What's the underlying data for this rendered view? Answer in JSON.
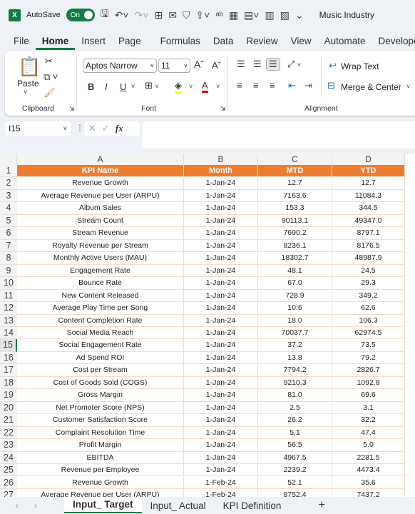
{
  "titlebar": {
    "autosave_label": "AutoSave",
    "autosave_state": "On",
    "doc_title": "Music Industry"
  },
  "menu_tabs": [
    "File",
    "Home",
    "Insert",
    "Page Layout",
    "Formulas",
    "Data",
    "Review",
    "View",
    "Automate",
    "Developer"
  ],
  "active_tab": "Home",
  "ribbon": {
    "paste": "Paste",
    "font_name": "Aptos Narrow",
    "font_size": "11",
    "wrap_text": "Wrap Text",
    "merge_center": "Merge & Center",
    "groups": {
      "clipboard": "Clipboard",
      "font": "Font",
      "alignment": "Alignment"
    },
    "bold": "B",
    "italic": "I",
    "underline": "U",
    "grow": "Aˆ",
    "shrink": "Aˇ",
    "font_color": "A",
    "fill_color": "#ffff00",
    "font_color_hex": "#e00000"
  },
  "formula_bar": {
    "name_box": "I15",
    "fx": "fx",
    "formula": ""
  },
  "columns": [
    "A",
    "B",
    "C",
    "D"
  ],
  "header": [
    "KPI Name",
    "Month",
    "MTD",
    "YTD"
  ],
  "rows": [
    [
      "Revenue Growth",
      "1-Jan-24",
      "12.7",
      "12.7"
    ],
    [
      "Average Revenue per User (ARPU)",
      "1-Jan-24",
      "7163.6",
      "11084.3"
    ],
    [
      "Album Sales",
      "1-Jan-24",
      "153.3",
      "344.5"
    ],
    [
      "Stream Count",
      "1-Jan-24",
      "90113.1",
      "49347.0"
    ],
    [
      "Stream Revenue",
      "1-Jan-24",
      "7690.2",
      "8797.1"
    ],
    [
      "Royalty Revenue per Stream",
      "1-Jan-24",
      "8236.1",
      "8176.5"
    ],
    [
      "Monthly Active Users (MAU)",
      "1-Jan-24",
      "18302.7",
      "48987.9"
    ],
    [
      "Engagement Rate",
      "1-Jan-24",
      "48.1",
      "24.5"
    ],
    [
      "Bounce Rate",
      "1-Jan-24",
      "67.0",
      "29.3"
    ],
    [
      "New Content Released",
      "1-Jan-24",
      "728.9",
      "349.2"
    ],
    [
      "Average Play Time per Song",
      "1-Jan-24",
      "10.6",
      "62.6"
    ],
    [
      "Content Completion Rate",
      "1-Jan-24",
      "18.0",
      "106.3"
    ],
    [
      "Social Media Reach",
      "1-Jan-24",
      "70037.7",
      "62974.5"
    ],
    [
      "Social Engagement Rate",
      "1-Jan-24",
      "37.2",
      "73.5"
    ],
    [
      "Ad Spend ROI",
      "1-Jan-24",
      "13.8",
      "79.2"
    ],
    [
      "Cost per Stream",
      "1-Jan-24",
      "7794.2",
      "2826.7"
    ],
    [
      "Cost of Goods Sold (COGS)",
      "1-Jan-24",
      "9210.3",
      "1092.8"
    ],
    [
      "Gross Margin",
      "1-Jan-24",
      "81.0",
      "69.6"
    ],
    [
      "Net Promoter Score (NPS)",
      "1-Jan-24",
      "2.5",
      "3.1"
    ],
    [
      "Customer Satisfaction Score",
      "1-Jan-24",
      "26.2",
      "32.2"
    ],
    [
      "Complaint Resolution Time",
      "1-Jan-24",
      "5.1",
      "47.4"
    ],
    [
      "Profit Margin",
      "1-Jan-24",
      "56.5",
      "5.0"
    ],
    [
      "EBITDA",
      "1-Jan-24",
      "4967.5",
      "2281.5"
    ],
    [
      "Revenue per Employee",
      "1-Jan-24",
      "2239.2",
      "4473.4"
    ],
    [
      "Revenue Growth",
      "1-Feb-24",
      "52.1",
      "35.6"
    ],
    [
      "Average Revenue per User (ARPU)",
      "1-Feb-24",
      "8752.4",
      "7437.2"
    ]
  ],
  "sheets": [
    "Input_ Target",
    "Input_ Actual",
    "KPI Definition"
  ],
  "active_sheet": "Input_ Target",
  "add_sheet": "+",
  "colors": {
    "header_fill": "#ed7d31",
    "accent": "#107c41"
  }
}
